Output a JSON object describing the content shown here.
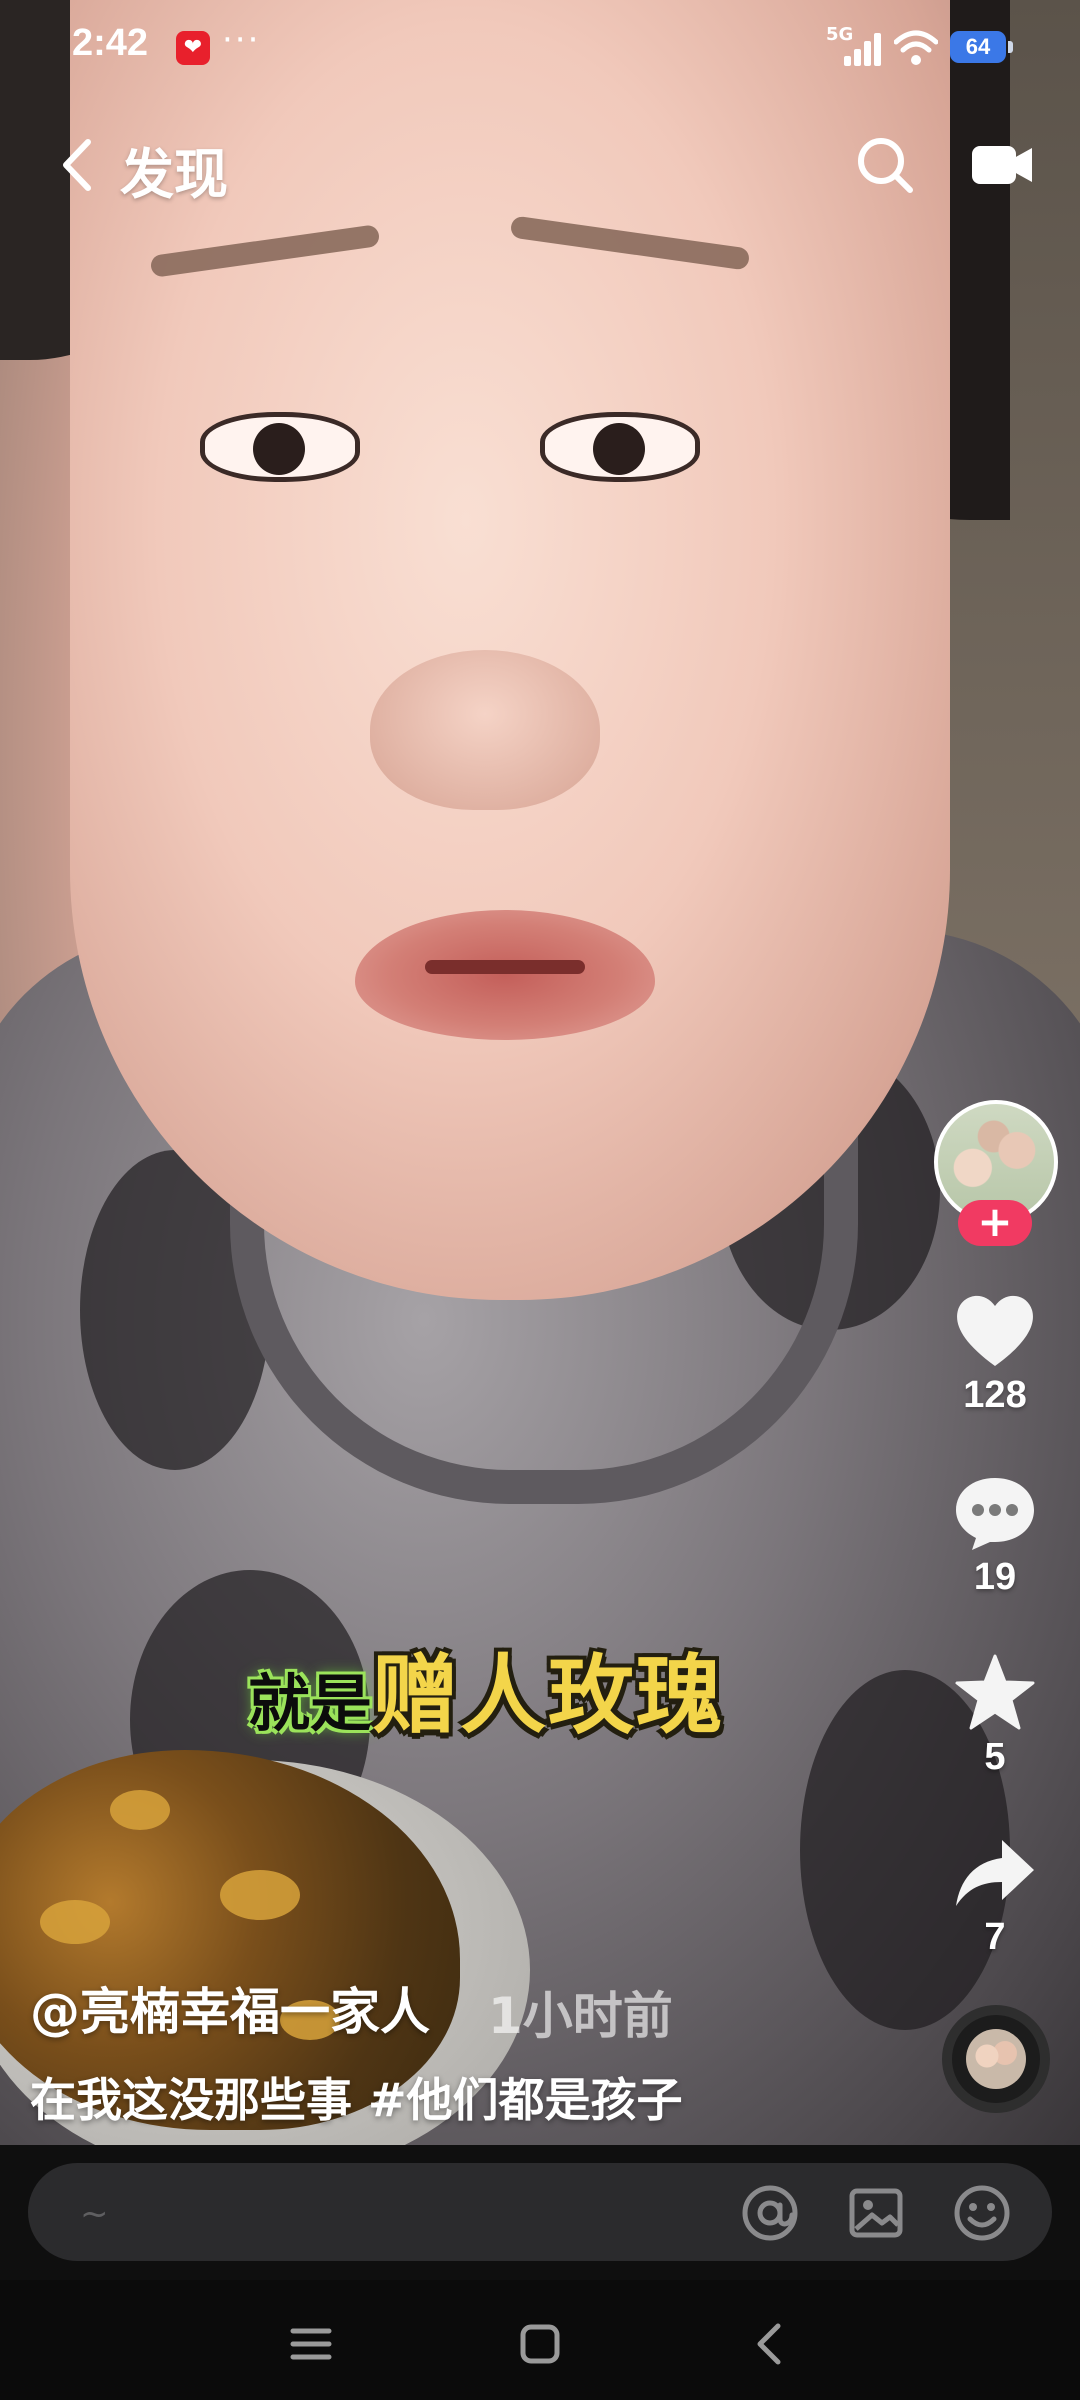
{
  "status_bar": {
    "time": "2:42",
    "more": "···",
    "network": "5G",
    "battery": "64"
  },
  "nav": {
    "title": "发现",
    "icons": [
      "back-icon",
      "search-icon",
      "camera-icon"
    ]
  },
  "video": {
    "caption_small": "就是",
    "caption_big": "赠人玫瑰"
  },
  "rail": {
    "follow_symbol": "+",
    "like_count": "128",
    "comment_count": "19",
    "favorite_count": "5",
    "share_count": "7"
  },
  "post": {
    "author": "@亮楠幸福一家人",
    "time": "1小时前",
    "description": "在我这没那些事 #他们都是孩子"
  },
  "comment": {
    "placeholder": "~"
  },
  "colors": {
    "follow_accent": "#f13a62",
    "battery_bg": "#3b78e7",
    "caption_yellow": "#f3d54a",
    "caption_green": "#9be35b"
  }
}
